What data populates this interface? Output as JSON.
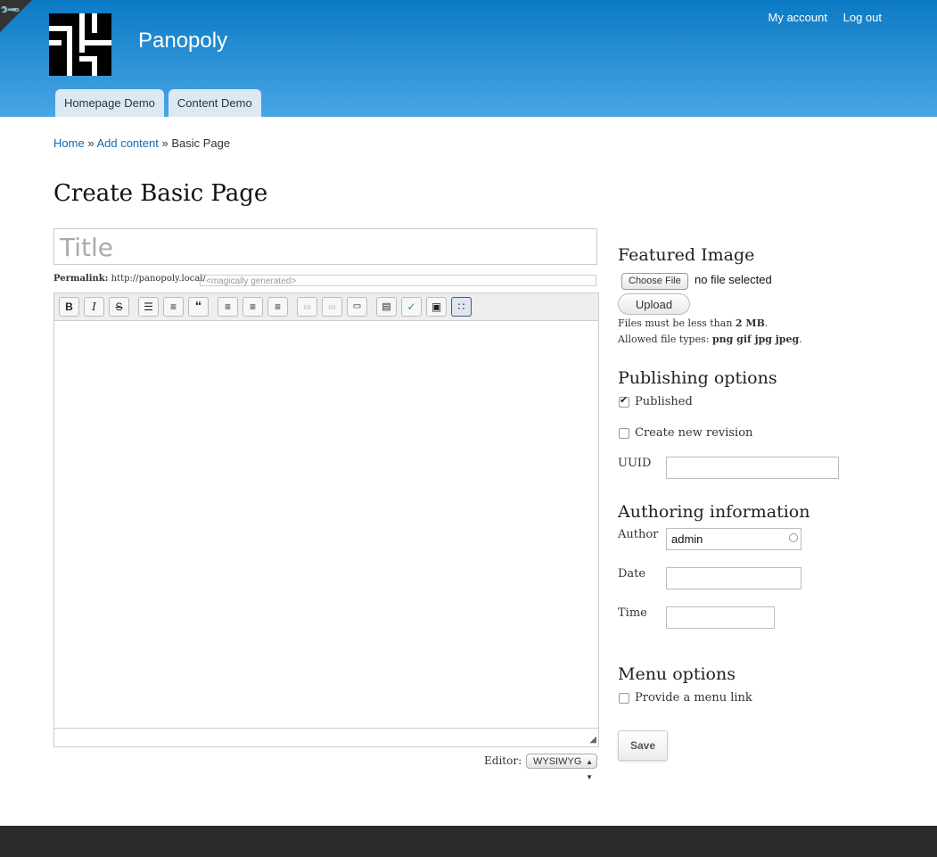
{
  "header": {
    "site_name": "Panopoly",
    "user_links": [
      "My account",
      "Log out"
    ],
    "tabs": [
      "Homepage Demo",
      "Content Demo"
    ]
  },
  "breadcrumb": {
    "home": "Home",
    "sep": "»",
    "add": "Add content",
    "current": "Basic Page"
  },
  "page_title": "Create Basic Page",
  "form": {
    "title_placeholder": "Title",
    "permalink_label": "Permalink:",
    "permalink_base": "http://panopoly.local/",
    "permalink_placeholder": "<magically generated>",
    "editor_label": "Editor:",
    "editor_value": "WYSIWYG"
  },
  "sidebar": {
    "featured_image": {
      "heading": "Featured Image",
      "choose_label": "Choose File",
      "no_file": "no file selected",
      "upload_label": "Upload",
      "size_note_prefix": "Files must be less than",
      "size_limit": "2 MB",
      "types_prefix": "Allowed file types:",
      "types": "png gif jpg jpeg"
    },
    "publishing": {
      "heading": "Publishing options",
      "published_label": "Published",
      "published_checked": true,
      "revision_label": "Create new revision",
      "uuid_label": "UUID",
      "uuid_value": ""
    },
    "authoring": {
      "heading": "Authoring information",
      "author_label": "Author",
      "author_value": "admin",
      "date_label": "Date",
      "time_label": "Time"
    },
    "menu": {
      "heading": "Menu options",
      "link_label": "Provide a menu link"
    },
    "save_label": "Save"
  }
}
